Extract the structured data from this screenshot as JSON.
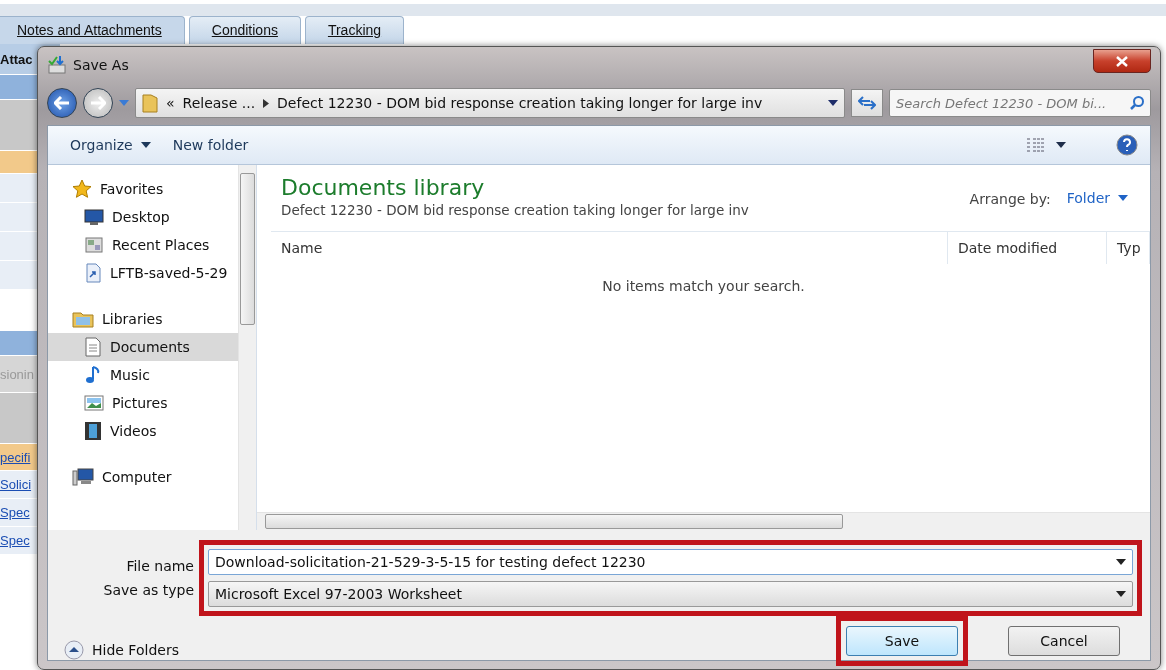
{
  "background": {
    "tabs": [
      {
        "label": "Notes and Attachments",
        "selected": true
      },
      {
        "label": "Conditions",
        "selected": false
      },
      {
        "label": "Tracking",
        "selected": false
      }
    ],
    "side_rows": [
      {
        "kind": "header",
        "text": "Attac"
      },
      {
        "kind": "blue"
      },
      {
        "kind": "grey"
      },
      {
        "kind": "orange"
      },
      {
        "kind": "light"
      },
      {
        "kind": "light"
      },
      {
        "kind": "light"
      },
      {
        "kind": "light"
      },
      {
        "kind": "gap"
      },
      {
        "kind": "blue"
      },
      {
        "kind": "muted",
        "text": "sionin"
      },
      {
        "kind": "grey"
      },
      {
        "kind": "orange_link",
        "text": "pecifi"
      },
      {
        "kind": "link",
        "text": "Solici"
      },
      {
        "kind": "link",
        "text": "Spec"
      },
      {
        "kind": "link",
        "text": "Spec"
      }
    ]
  },
  "dialog": {
    "title": "Save As",
    "address": {
      "overflow": "«",
      "crumbs": [
        "Release ...",
        "Defect 12230 - DOM bid response creation taking longer for large inv"
      ]
    },
    "search": {
      "placeholder": "Search Defect 12230 - DOM bi..."
    },
    "toolbar": {
      "organize": "Organize",
      "new_folder": "New folder"
    },
    "nav": [
      {
        "kind": "group",
        "label": "Favorites",
        "selected": false
      },
      {
        "kind": "item",
        "label": "Desktop",
        "selected": false
      },
      {
        "kind": "item",
        "label": "Recent Places",
        "selected": false
      },
      {
        "kind": "item",
        "label": "LFTB-saved-5-29",
        "selected": false
      },
      {
        "kind": "group",
        "label": "Libraries",
        "selected": false
      },
      {
        "kind": "item",
        "label": "Documents",
        "selected": true
      },
      {
        "kind": "item",
        "label": "Music",
        "selected": false
      },
      {
        "kind": "item",
        "label": "Pictures",
        "selected": false
      },
      {
        "kind": "item",
        "label": "Videos",
        "selected": false
      },
      {
        "kind": "group",
        "label": "Computer",
        "selected": false
      }
    ],
    "library": {
      "title": "Documents library",
      "subtitle": "Defect 12230 - DOM bid response creation taking longer for large inv",
      "arrange_label": "Arrange by:",
      "arrange_value": "Folder"
    },
    "columns": [
      "Name",
      "Date modified",
      "Typ"
    ],
    "empty_message": "No items match your search.",
    "file_fields": {
      "highlight": true,
      "file_name_label": "File name",
      "file_name": "Download-solicitation-21-529-3-5-15 for testing defect 12230",
      "type_label": "Save as type",
      "type": "Microsoft Excel 97-2003 Worksheet"
    },
    "hide_folders": "Hide Folders",
    "buttons": [
      {
        "label": "Save",
        "highlight": true
      },
      {
        "label": "Cancel",
        "highlight": false
      }
    ]
  }
}
